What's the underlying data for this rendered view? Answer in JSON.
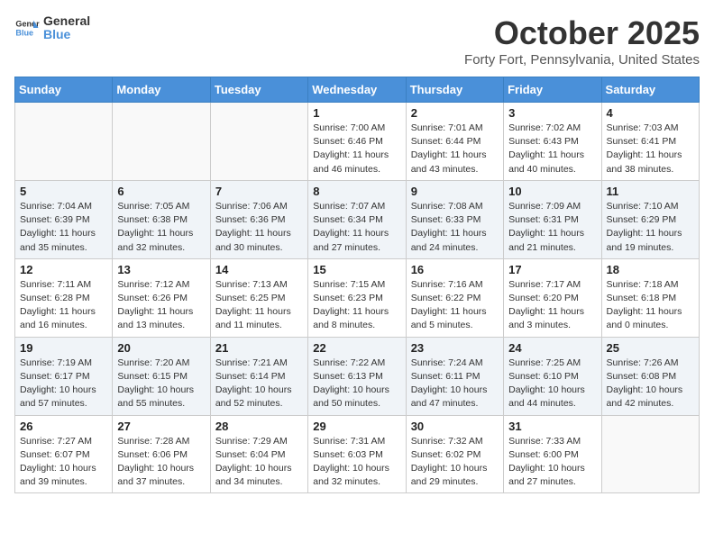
{
  "header": {
    "logo_line1": "General",
    "logo_line2": "Blue",
    "month": "October 2025",
    "location": "Forty Fort, Pennsylvania, United States"
  },
  "weekdays": [
    "Sunday",
    "Monday",
    "Tuesday",
    "Wednesday",
    "Thursday",
    "Friday",
    "Saturday"
  ],
  "weeks": [
    [
      {
        "day": "",
        "sunrise": "",
        "sunset": "",
        "daylight": ""
      },
      {
        "day": "",
        "sunrise": "",
        "sunset": "",
        "daylight": ""
      },
      {
        "day": "",
        "sunrise": "",
        "sunset": "",
        "daylight": ""
      },
      {
        "day": "1",
        "sunrise": "Sunrise: 7:00 AM",
        "sunset": "Sunset: 6:46 PM",
        "daylight": "Daylight: 11 hours and 46 minutes."
      },
      {
        "day": "2",
        "sunrise": "Sunrise: 7:01 AM",
        "sunset": "Sunset: 6:44 PM",
        "daylight": "Daylight: 11 hours and 43 minutes."
      },
      {
        "day": "3",
        "sunrise": "Sunrise: 7:02 AM",
        "sunset": "Sunset: 6:43 PM",
        "daylight": "Daylight: 11 hours and 40 minutes."
      },
      {
        "day": "4",
        "sunrise": "Sunrise: 7:03 AM",
        "sunset": "Sunset: 6:41 PM",
        "daylight": "Daylight: 11 hours and 38 minutes."
      }
    ],
    [
      {
        "day": "5",
        "sunrise": "Sunrise: 7:04 AM",
        "sunset": "Sunset: 6:39 PM",
        "daylight": "Daylight: 11 hours and 35 minutes."
      },
      {
        "day": "6",
        "sunrise": "Sunrise: 7:05 AM",
        "sunset": "Sunset: 6:38 PM",
        "daylight": "Daylight: 11 hours and 32 minutes."
      },
      {
        "day": "7",
        "sunrise": "Sunrise: 7:06 AM",
        "sunset": "Sunset: 6:36 PM",
        "daylight": "Daylight: 11 hours and 30 minutes."
      },
      {
        "day": "8",
        "sunrise": "Sunrise: 7:07 AM",
        "sunset": "Sunset: 6:34 PM",
        "daylight": "Daylight: 11 hours and 27 minutes."
      },
      {
        "day": "9",
        "sunrise": "Sunrise: 7:08 AM",
        "sunset": "Sunset: 6:33 PM",
        "daylight": "Daylight: 11 hours and 24 minutes."
      },
      {
        "day": "10",
        "sunrise": "Sunrise: 7:09 AM",
        "sunset": "Sunset: 6:31 PM",
        "daylight": "Daylight: 11 hours and 21 minutes."
      },
      {
        "day": "11",
        "sunrise": "Sunrise: 7:10 AM",
        "sunset": "Sunset: 6:29 PM",
        "daylight": "Daylight: 11 hours and 19 minutes."
      }
    ],
    [
      {
        "day": "12",
        "sunrise": "Sunrise: 7:11 AM",
        "sunset": "Sunset: 6:28 PM",
        "daylight": "Daylight: 11 hours and 16 minutes."
      },
      {
        "day": "13",
        "sunrise": "Sunrise: 7:12 AM",
        "sunset": "Sunset: 6:26 PM",
        "daylight": "Daylight: 11 hours and 13 minutes."
      },
      {
        "day": "14",
        "sunrise": "Sunrise: 7:13 AM",
        "sunset": "Sunset: 6:25 PM",
        "daylight": "Daylight: 11 hours and 11 minutes."
      },
      {
        "day": "15",
        "sunrise": "Sunrise: 7:15 AM",
        "sunset": "Sunset: 6:23 PM",
        "daylight": "Daylight: 11 hours and 8 minutes."
      },
      {
        "day": "16",
        "sunrise": "Sunrise: 7:16 AM",
        "sunset": "Sunset: 6:22 PM",
        "daylight": "Daylight: 11 hours and 5 minutes."
      },
      {
        "day": "17",
        "sunrise": "Sunrise: 7:17 AM",
        "sunset": "Sunset: 6:20 PM",
        "daylight": "Daylight: 11 hours and 3 minutes."
      },
      {
        "day": "18",
        "sunrise": "Sunrise: 7:18 AM",
        "sunset": "Sunset: 6:18 PM",
        "daylight": "Daylight: 11 hours and 0 minutes."
      }
    ],
    [
      {
        "day": "19",
        "sunrise": "Sunrise: 7:19 AM",
        "sunset": "Sunset: 6:17 PM",
        "daylight": "Daylight: 10 hours and 57 minutes."
      },
      {
        "day": "20",
        "sunrise": "Sunrise: 7:20 AM",
        "sunset": "Sunset: 6:15 PM",
        "daylight": "Daylight: 10 hours and 55 minutes."
      },
      {
        "day": "21",
        "sunrise": "Sunrise: 7:21 AM",
        "sunset": "Sunset: 6:14 PM",
        "daylight": "Daylight: 10 hours and 52 minutes."
      },
      {
        "day": "22",
        "sunrise": "Sunrise: 7:22 AM",
        "sunset": "Sunset: 6:13 PM",
        "daylight": "Daylight: 10 hours and 50 minutes."
      },
      {
        "day": "23",
        "sunrise": "Sunrise: 7:24 AM",
        "sunset": "Sunset: 6:11 PM",
        "daylight": "Daylight: 10 hours and 47 minutes."
      },
      {
        "day": "24",
        "sunrise": "Sunrise: 7:25 AM",
        "sunset": "Sunset: 6:10 PM",
        "daylight": "Daylight: 10 hours and 44 minutes."
      },
      {
        "day": "25",
        "sunrise": "Sunrise: 7:26 AM",
        "sunset": "Sunset: 6:08 PM",
        "daylight": "Daylight: 10 hours and 42 minutes."
      }
    ],
    [
      {
        "day": "26",
        "sunrise": "Sunrise: 7:27 AM",
        "sunset": "Sunset: 6:07 PM",
        "daylight": "Daylight: 10 hours and 39 minutes."
      },
      {
        "day": "27",
        "sunrise": "Sunrise: 7:28 AM",
        "sunset": "Sunset: 6:06 PM",
        "daylight": "Daylight: 10 hours and 37 minutes."
      },
      {
        "day": "28",
        "sunrise": "Sunrise: 7:29 AM",
        "sunset": "Sunset: 6:04 PM",
        "daylight": "Daylight: 10 hours and 34 minutes."
      },
      {
        "day": "29",
        "sunrise": "Sunrise: 7:31 AM",
        "sunset": "Sunset: 6:03 PM",
        "daylight": "Daylight: 10 hours and 32 minutes."
      },
      {
        "day": "30",
        "sunrise": "Sunrise: 7:32 AM",
        "sunset": "Sunset: 6:02 PM",
        "daylight": "Daylight: 10 hours and 29 minutes."
      },
      {
        "day": "31",
        "sunrise": "Sunrise: 7:33 AM",
        "sunset": "Sunset: 6:00 PM",
        "daylight": "Daylight: 10 hours and 27 minutes."
      },
      {
        "day": "",
        "sunrise": "",
        "sunset": "",
        "daylight": ""
      }
    ]
  ]
}
